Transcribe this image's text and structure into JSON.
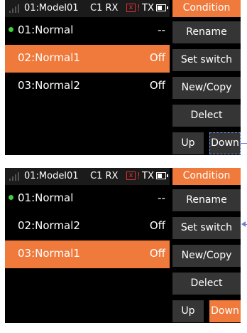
{
  "colors": {
    "accent": "#f07a3c",
    "screen_bg": "#000000",
    "button_bg": "#353535",
    "text": "#ffffff",
    "status_ok": "#3fcf3f",
    "alert": "#e23030"
  },
  "screens": [
    {
      "status": {
        "model": "01:Model01",
        "rx_label": "C1 RX",
        "rx_battery_icon": "x",
        "rx_warning": "!",
        "tx_label": "TX"
      },
      "title": "Condition",
      "rows": [
        {
          "name": "01:Normal",
          "value": "--",
          "active": true,
          "selected": false
        },
        {
          "name": "02:Normal1",
          "value": "Off",
          "active": false,
          "selected": true
        },
        {
          "name": "03:Normal2",
          "value": "Off",
          "active": false,
          "selected": false
        }
      ],
      "buttons": {
        "rename": "Rename",
        "set_switch": "Set switch",
        "new_copy": "New/Copy",
        "delect": "Delect",
        "up": "Up",
        "down": "Down"
      }
    },
    {
      "status": {
        "model": "01:Model01",
        "rx_label": "C1 RX",
        "rx_battery_icon": "x",
        "rx_warning": "!",
        "tx_label": "TX"
      },
      "title": "Condition",
      "rows": [
        {
          "name": "01:Normal",
          "value": "--",
          "active": true,
          "selected": false
        },
        {
          "name": "02:Normal2",
          "value": "Off",
          "active": false,
          "selected": false
        },
        {
          "name": "03:Normal1",
          "value": "Off",
          "active": false,
          "selected": true
        }
      ],
      "buttons": {
        "rename": "Rename",
        "set_switch": "Set switch",
        "new_copy": "New/Copy",
        "delect": "Delect",
        "up": "Up",
        "down": "Down"
      }
    }
  ]
}
